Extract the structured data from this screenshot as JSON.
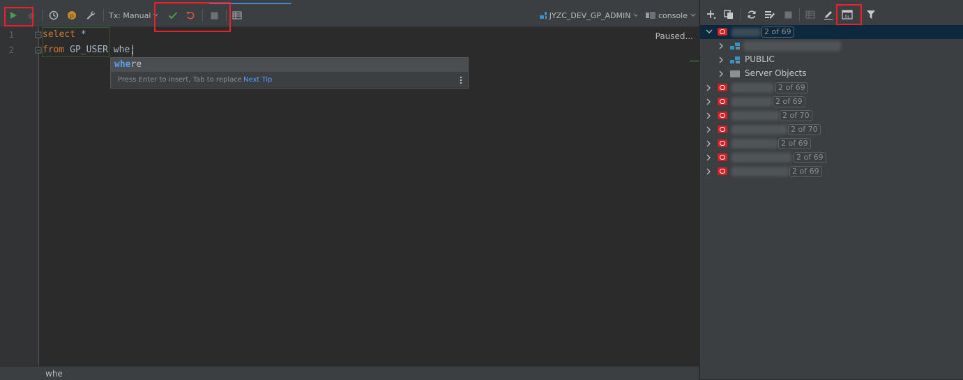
{
  "toolbar": {
    "tx_mode": "Tx: Manual",
    "datasource": "JYZC_DEV_GP_ADMIN",
    "console": "console"
  },
  "editor": {
    "line_numbers": [
      "1",
      "2"
    ],
    "line1_kw": "select",
    "line1_rest": " *",
    "line2_kw": "from",
    "line2_rest": " GP_USER whe;",
    "status": "Paused..."
  },
  "completion": {
    "match": "whe",
    "rest": "re",
    "hint": "Press Enter to insert, Tab to replace",
    "next_tip": "Next Tip"
  },
  "statusbar": {
    "text": "whe"
  },
  "tree": {
    "items": [
      {
        "badge": "2 of 69"
      },
      {
        "label": "PUBLIC"
      },
      {
        "label": "Server Objects"
      },
      {
        "badge": "2 of 69"
      },
      {
        "badge": "2 of 69"
      },
      {
        "badge": "2 of 70"
      },
      {
        "badge": "2 of 70"
      },
      {
        "badge": "2 of 69"
      },
      {
        "badge": "2 of 69"
      },
      {
        "badge": "2 of 69"
      }
    ]
  },
  "colors": {
    "accent": "#4a88c7",
    "highlight_box": "#e8212b",
    "keyword": "#cc7832",
    "oracle": "#d11f26"
  }
}
